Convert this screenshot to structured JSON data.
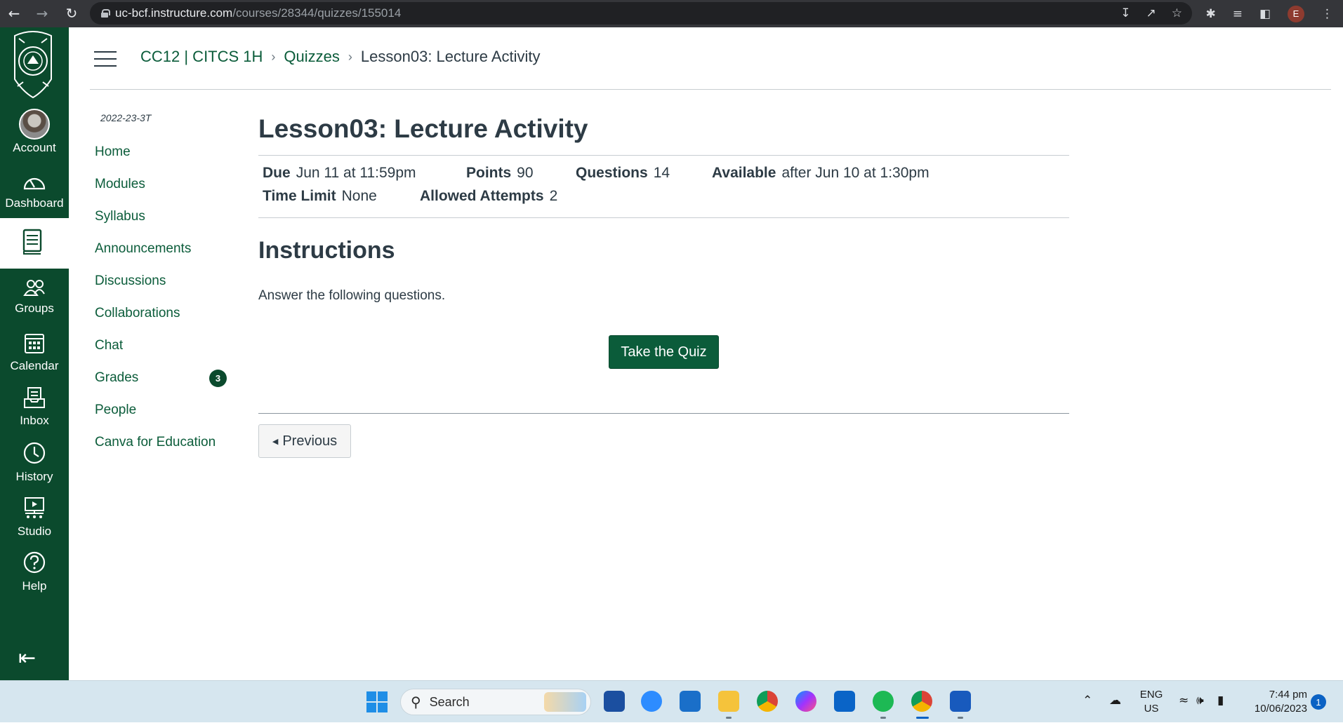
{
  "browser": {
    "url_host": "uc-bcf.instructure.com",
    "url_path": "/courses/28344/quizzes/155014",
    "profile_initial": "E"
  },
  "global_nav": {
    "items": [
      {
        "label": "Account",
        "icon": "avatar"
      },
      {
        "label": "Dashboard",
        "icon": "dashboard-icon"
      },
      {
        "label": "",
        "icon": "courses-icon"
      },
      {
        "label": "Groups",
        "icon": "groups-icon"
      },
      {
        "label": "Calendar",
        "icon": "calendar-icon"
      },
      {
        "label": "Inbox",
        "icon": "inbox-icon"
      },
      {
        "label": "History",
        "icon": "history-icon"
      },
      {
        "label": "Studio",
        "icon": "studio-icon"
      },
      {
        "label": "Help",
        "icon": "help-icon"
      }
    ]
  },
  "breadcrumb": {
    "course": "CC12 | CITCS 1H",
    "section": "Quizzes",
    "current": "Lesson03: Lecture Activity"
  },
  "course_nav": {
    "term": "2022-23-3T",
    "items": [
      {
        "label": "Home"
      },
      {
        "label": "Modules"
      },
      {
        "label": "Syllabus"
      },
      {
        "label": "Announcements"
      },
      {
        "label": "Discussions"
      },
      {
        "label": "Collaborations"
      },
      {
        "label": "Chat"
      },
      {
        "label": "Grades",
        "badge": "3"
      },
      {
        "label": "People"
      },
      {
        "label": "Canva for Education"
      }
    ]
  },
  "quiz": {
    "title": "Lesson03: Lecture Activity",
    "due_label": "Due",
    "due_value": "Jun 11 at 11:59pm",
    "points_label": "Points",
    "points_value": "90",
    "questions_label": "Questions",
    "questions_value": "14",
    "available_label": "Available",
    "available_value": "after Jun 10 at 1:30pm",
    "time_limit_label": "Time Limit",
    "time_limit_value": "None",
    "attempts_label": "Allowed Attempts",
    "attempts_value": "2",
    "instructions_heading": "Instructions",
    "instructions_text": "Answer the following questions.",
    "take_button": "Take the Quiz",
    "previous_button": "Previous"
  },
  "taskbar": {
    "search_placeholder": "Search",
    "lang_top": "ENG",
    "lang_bottom": "US",
    "time": "7:44 pm",
    "date": "10/06/2023",
    "notification_count": "1"
  },
  "colors": {
    "brand_green": "#0b4a2d",
    "link_green": "#0b5c3a",
    "text": "#2d3b45"
  }
}
